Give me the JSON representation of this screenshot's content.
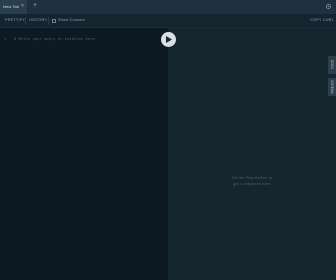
{
  "tabs": [
    {
      "label": "New Tab",
      "close_icon": "close-icon"
    }
  ],
  "add_tab_icon": "plus-icon",
  "settings_icon": "gear-icon",
  "toolbar": {
    "buttons": [
      "PRETTIFY",
      "HISTORY"
    ],
    "checkbox_label": "Show Console",
    "copy_label": "COPY CURL"
  },
  "editor": {
    "line_number": "1",
    "code": "# Write your query or mutation here"
  },
  "run_icon": "play-icon",
  "preview": {
    "message_line1": "Hit the Play Button to",
    "message_line2": "get a response here"
  },
  "side_tabs": [
    "DOCS",
    "SCHEMA"
  ],
  "colors": {
    "tabbar": "#1f313e",
    "editor_bg": "#0d1a24",
    "preview_bg": "#16262f",
    "run_button": "#d9dfe4"
  }
}
